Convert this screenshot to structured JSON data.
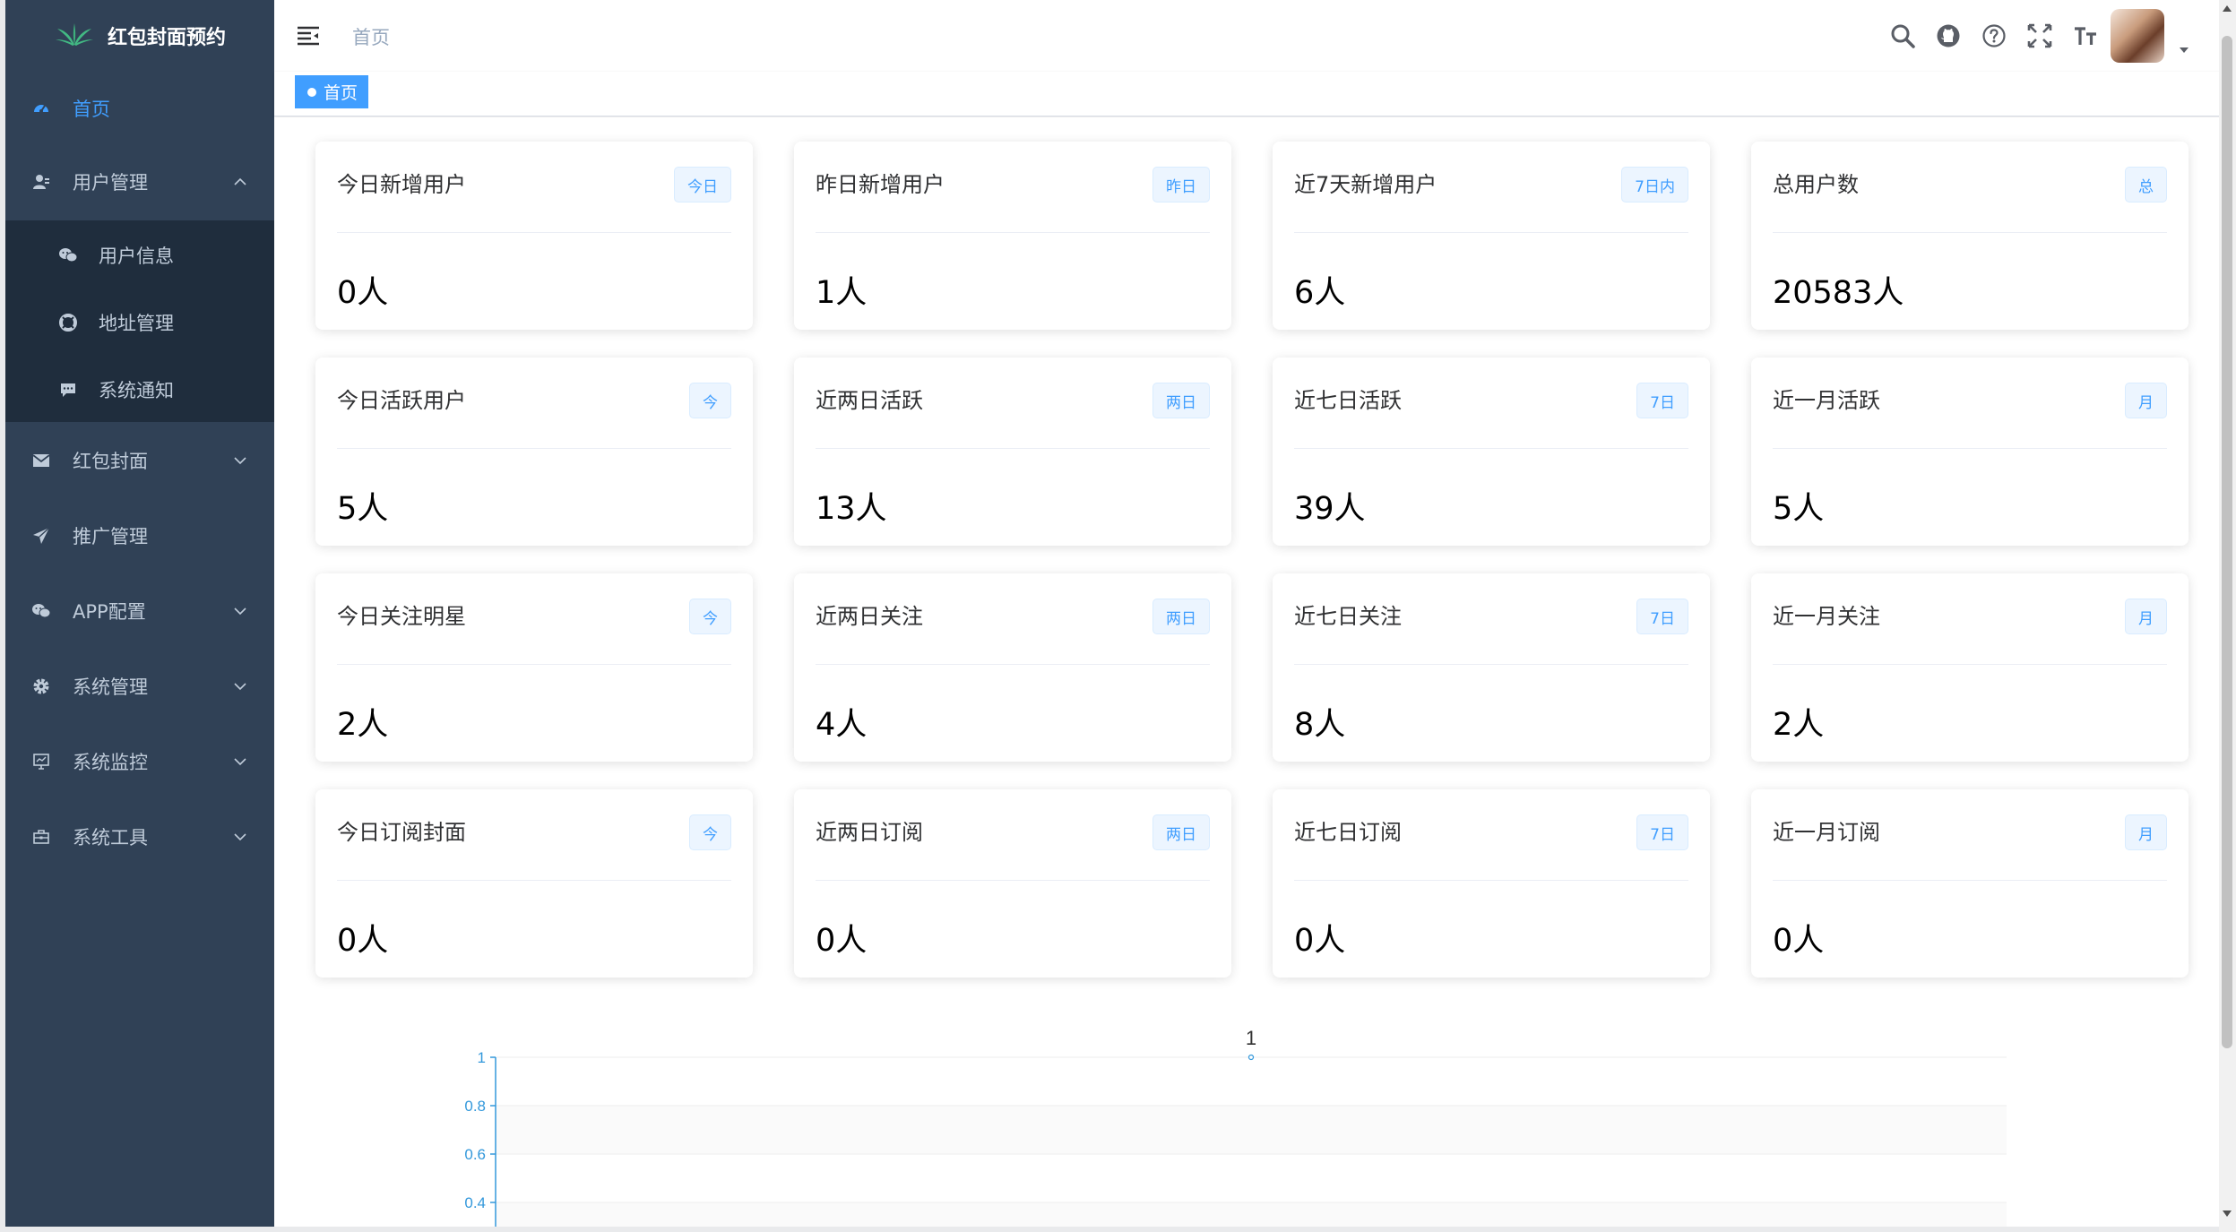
{
  "sidebar": {
    "logo_text": "红包封面预约",
    "menu": {
      "home": "首页",
      "user_mgmt": "用户管理",
      "user_info": "用户信息",
      "address_mgmt": "地址管理",
      "system_notice": "系统通知",
      "red_packet_cover": "红包封面",
      "promotion": "推广管理",
      "app_config": "APP配置",
      "system_mgmt": "系统管理",
      "system_monitor": "系统监控",
      "system_tools": "系统工具"
    }
  },
  "navbar": {
    "breadcrumb": "首页",
    "icons": [
      "search-icon",
      "github-icon",
      "question-icon",
      "fullscreen-icon",
      "font-size-icon"
    ]
  },
  "tagsview": {
    "active_tag": "首页"
  },
  "cards": [
    {
      "title": "今日新增用户",
      "badge": "今日",
      "value": "0人"
    },
    {
      "title": "昨日新增用户",
      "badge": "昨日",
      "value": "1人"
    },
    {
      "title": "近7天新增用户",
      "badge": "7日内",
      "value": "6人"
    },
    {
      "title": "总用户数",
      "badge": "总",
      "value": "20583人"
    },
    {
      "title": "今日活跃用户",
      "badge": "今",
      "value": "5人"
    },
    {
      "title": "近两日活跃",
      "badge": "两日",
      "value": "13人"
    },
    {
      "title": "近七日活跃",
      "badge": "7日",
      "value": "39人"
    },
    {
      "title": "近一月活跃",
      "badge": "月",
      "value": "5人"
    },
    {
      "title": "今日关注明星",
      "badge": "今",
      "value": "2人"
    },
    {
      "title": "近两日关注",
      "badge": "两日",
      "value": "4人"
    },
    {
      "title": "近七日关注",
      "badge": "7日",
      "value": "8人"
    },
    {
      "title": "近一月关注",
      "badge": "月",
      "value": "2人"
    },
    {
      "title": "今日订阅封面",
      "badge": "今",
      "value": "0人"
    },
    {
      "title": "近两日订阅",
      "badge": "两日",
      "value": "0人"
    },
    {
      "title": "近七日订阅",
      "badge": "7日",
      "value": "0人"
    },
    {
      "title": "近一月订阅",
      "badge": "月",
      "value": "0人"
    }
  ],
  "chart_data": {
    "type": "line",
    "title": "",
    "xlabel": "",
    "ylabel": "",
    "ylim": [
      0,
      1
    ],
    "y_ticks_visible": [
      "1",
      "0.8",
      "0.6",
      "0.4"
    ],
    "series": [
      {
        "values": [
          1
        ]
      }
    ],
    "data_labels": [
      "1"
    ],
    "colors": {
      "axis": "#3398db",
      "band": "#fafafa"
    }
  },
  "colors": {
    "sidebar_bg": "#304156",
    "submenu_bg": "#1f2d3d",
    "accent": "#409eff"
  }
}
